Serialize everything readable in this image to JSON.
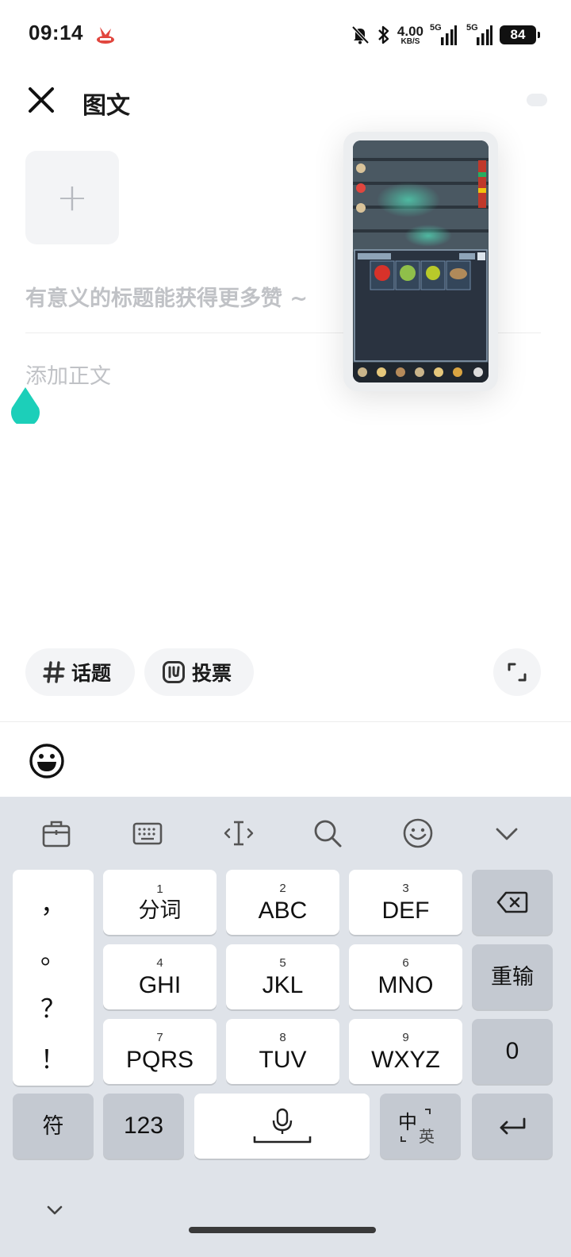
{
  "status_bar": {
    "time": "09:14",
    "net_speed_value": "4.00",
    "net_speed_unit": "KB/S",
    "signal1_label": "5G",
    "signal2_label": "5G",
    "battery": "84"
  },
  "header": {
    "title": "图文"
  },
  "editor": {
    "add_image_label": "+",
    "title_placeholder": "有意义的标题能获得更多赞 ~",
    "body_placeholder": "添加正文"
  },
  "chips": {
    "topic_label": "话题",
    "vote_label": "投票"
  },
  "keyboard": {
    "punctuation": [
      "，",
      "。",
      "？",
      "！"
    ],
    "keys": [
      {
        "num": "1",
        "label": "分词"
      },
      {
        "num": "2",
        "label": "ABC"
      },
      {
        "num": "3",
        "label": "DEF"
      },
      {
        "num": "4",
        "label": "GHI"
      },
      {
        "num": "5",
        "label": "JKL"
      },
      {
        "num": "6",
        "label": "MNO"
      },
      {
        "num": "7",
        "label": "PQRS"
      },
      {
        "num": "8",
        "label": "TUV"
      },
      {
        "num": "9",
        "label": "WXYZ"
      }
    ],
    "retype_label": "重输",
    "zero_label": "0",
    "symbol_label": "符",
    "numeric_label": "123",
    "lang_main": "中",
    "lang_sub": "英"
  },
  "colors": {
    "accent_handle": "#1ccfb9",
    "keyboard_bg": "#dfe3e9",
    "function_key": "#c4c9d1"
  },
  "icons": {
    "close": "close-icon",
    "hashtag": "hashtag-icon",
    "vote": "vote-icon",
    "expand": "expand-icon",
    "emoji": "emoji-icon",
    "clipboard": "clipboard-icon",
    "keyboard": "keyboard-icon",
    "cursor": "cursor-move-icon",
    "search": "search-icon",
    "backspace": "backspace-icon",
    "mic": "microphone-icon",
    "enter": "enter-icon"
  }
}
